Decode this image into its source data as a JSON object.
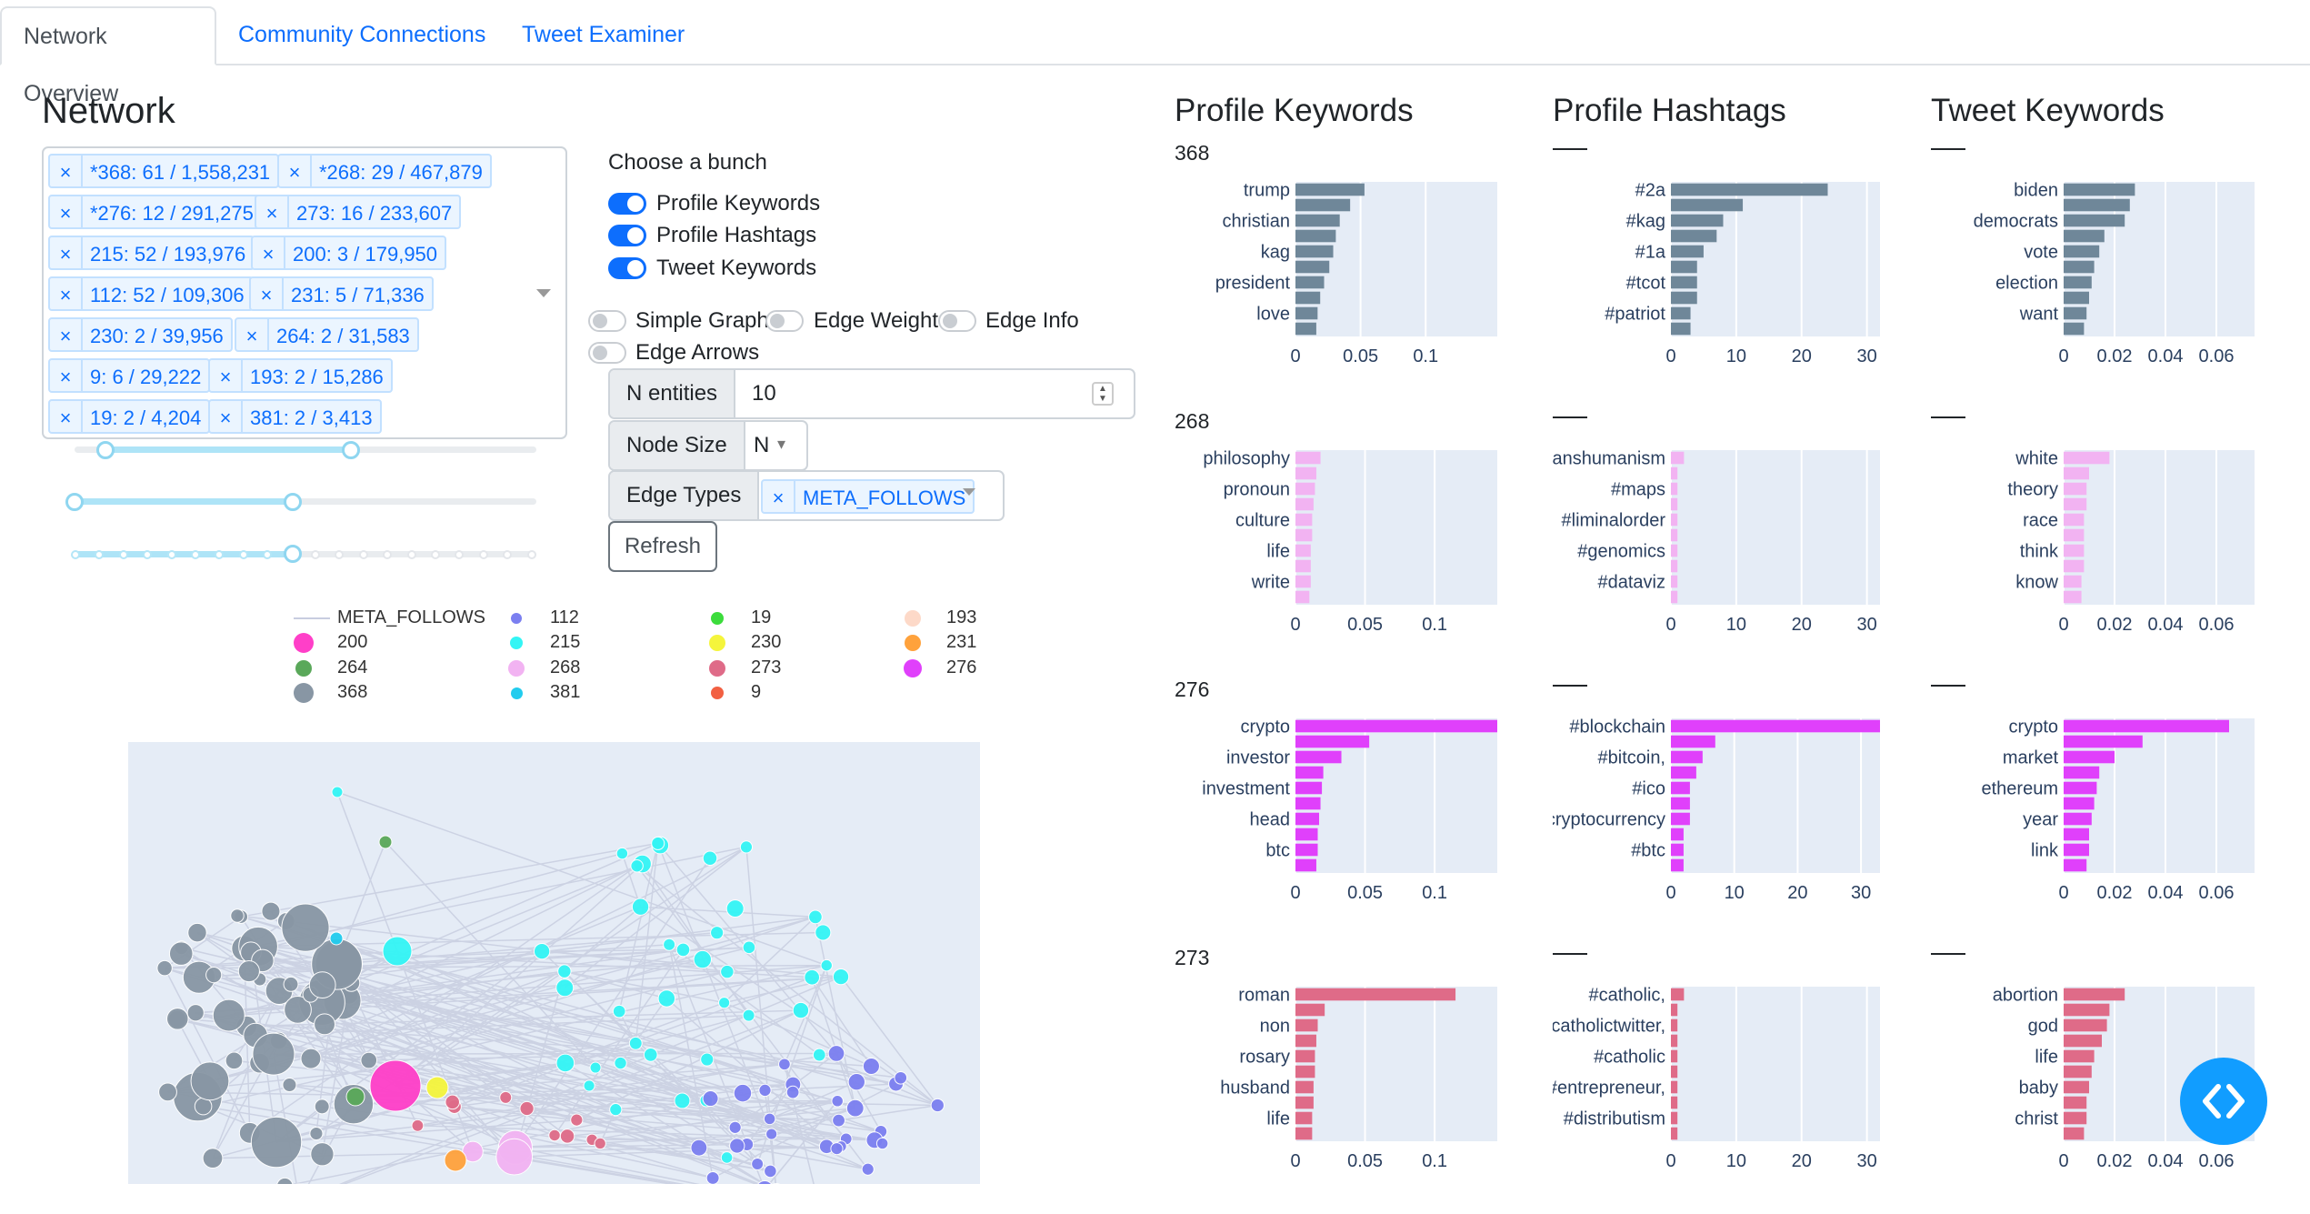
{
  "tabs": [
    {
      "label": "Network Overview",
      "active": true
    },
    {
      "label": "Community Connections",
      "active": false
    },
    {
      "label": "Tweet Examiner",
      "active": false
    }
  ],
  "network": {
    "title": "Network",
    "communities": [
      "*368: 61 / 1,558,231",
      "*268: 29 / 467,879",
      "*276: 12 / 291,275",
      "273: 16 / 233,607",
      "215: 52 / 193,976",
      "200: 3 / 179,950",
      "112: 52 / 109,306",
      "231: 5 / 71,336",
      "230: 2 / 39,956",
      "264: 2 / 31,583",
      "9: 6 / 29,222",
      "193: 2 / 15,286",
      "19: 2 / 4,204",
      "381: 2 / 3,413"
    ]
  },
  "controls": {
    "choose_label": "Choose a bunch",
    "toggles_on": [
      {
        "label": "Profile Keywords",
        "on": true
      },
      {
        "label": "Profile Hashtags",
        "on": true
      },
      {
        "label": "Tweet Keywords",
        "on": true
      }
    ],
    "toggles_off": [
      {
        "label": "Simple Graph",
        "on": false
      },
      {
        "label": "Edge Weight",
        "on": false
      },
      {
        "label": "Edge Info",
        "on": false
      },
      {
        "label": "Edge Arrows",
        "on": false
      }
    ],
    "n_entities_label": "N entities",
    "n_entities_value": "10",
    "node_size_label": "Node Size",
    "node_size_value": "N",
    "edge_types_label": "Edge Types",
    "edge_type_selected": "META_FOLLOWS",
    "refresh_label": "Refresh"
  },
  "legend": [
    {
      "label": "META_FOLLOWS",
      "type": "line",
      "color": "#c8cde0"
    },
    {
      "label": "112",
      "color": "#7b7ff0"
    },
    {
      "label": "19",
      "color": "#3cdc3c"
    },
    {
      "label": "193",
      "color": "#fdd9c8"
    },
    {
      "label": "200",
      "color": "#ff3fc8"
    },
    {
      "label": "215",
      "color": "#33f5f5"
    },
    {
      "label": "230",
      "color": "#f5f53c"
    },
    {
      "label": "231",
      "color": "#ffa23c"
    },
    {
      "label": "264",
      "color": "#5aa85a"
    },
    {
      "label": "268",
      "color": "#f2b3f2"
    },
    {
      "label": "273",
      "color": "#df6b88"
    },
    {
      "label": "276",
      "color": "#e040fb"
    },
    {
      "label": "368",
      "color": "#8896a4"
    },
    {
      "label": "381",
      "color": "#22ccee"
    },
    {
      "label": "9",
      "color": "#f26042"
    }
  ],
  "headers": {
    "profile_keywords": "Profile Keywords",
    "profile_hashtags": "Profile Hashtags",
    "tweet_keywords": "Tweet Keywords"
  },
  "chart_data": [
    {
      "type": "bar",
      "orientation": "horizontal",
      "row_label": "368",
      "column": "Profile Keywords",
      "color": "#6f8799",
      "categories": [
        "trump",
        "christian",
        "kag",
        "president",
        "love"
      ],
      "tick_labels_y": [
        "trump",
        "christian",
        "kag",
        "president",
        "love"
      ],
      "values": [
        0.053,
        0.042,
        0.034,
        0.031,
        0.029,
        0.026,
        0.022,
        0.019,
        0.017,
        0.016
      ],
      "xticks": [
        "0",
        "0.05",
        "0.1"
      ],
      "xlim": [
        0,
        0.155
      ]
    },
    {
      "type": "bar",
      "orientation": "horizontal",
      "row_label": "",
      "column": "Profile Hashtags",
      "color": "#6f8799",
      "categories": [
        "#2a",
        "#kag",
        "#1a",
        "#tcot",
        "#patriot"
      ],
      "values": [
        24,
        11,
        8,
        7,
        5,
        4,
        4,
        4,
        3,
        3
      ],
      "xticks": [
        "0",
        "10",
        "20",
        "30"
      ],
      "xlim": [
        0,
        32
      ]
    },
    {
      "type": "bar",
      "orientation": "horizontal",
      "row_label": "",
      "column": "Tweet Keywords",
      "color": "#6f8799",
      "categories": [
        "biden",
        "democrats",
        "vote",
        "election",
        "want"
      ],
      "values": [
        0.028,
        0.026,
        0.024,
        0.016,
        0.014,
        0.012,
        0.011,
        0.01,
        0.009,
        0.008
      ],
      "xticks": [
        "0",
        "0.02",
        "0.04",
        "0.06"
      ],
      "xlim": [
        0,
        0.075
      ]
    },
    {
      "type": "bar",
      "orientation": "horizontal",
      "row_label": "268",
      "column": "Profile Keywords",
      "color": "#f2b3f2",
      "categories": [
        "philosophy",
        "pronoun",
        "culture",
        "life",
        "write"
      ],
      "values": [
        0.018,
        0.015,
        0.014,
        0.013,
        0.012,
        0.012,
        0.011,
        0.011,
        0.011,
        0.01
      ],
      "xticks": [
        "0",
        "0.05",
        "0.1"
      ],
      "xlim": [
        0,
        0.145
      ]
    },
    {
      "type": "bar",
      "orientation": "horizontal",
      "row_label": "",
      "column": "Profile Hashtags",
      "color": "#f2b3f2",
      "categories": [
        "#transhumanism",
        "#maps",
        "#liminalorder",
        "#genomics",
        "#dataviz"
      ],
      "values": [
        2,
        1,
        1,
        1,
        1,
        1,
        1,
        1,
        1,
        1
      ],
      "xticks": [
        "0",
        "10",
        "20",
        "30"
      ],
      "xlim": [
        0,
        32
      ]
    },
    {
      "type": "bar",
      "orientation": "horizontal",
      "row_label": "",
      "column": "Tweet Keywords",
      "color": "#f2b3f2",
      "categories": [
        "white",
        "theory",
        "race",
        "think",
        "know"
      ],
      "values": [
        0.018,
        0.01,
        0.009,
        0.009,
        0.008,
        0.008,
        0.008,
        0.008,
        0.007,
        0.007
      ],
      "xticks": [
        "0",
        "0.02",
        "0.04",
        "0.06"
      ],
      "xlim": [
        0,
        0.075
      ]
    },
    {
      "type": "bar",
      "orientation": "horizontal",
      "row_label": "276",
      "column": "Profile Keywords",
      "color": "#e040fb",
      "categories": [
        "crypto",
        "investor",
        "investment",
        "head",
        "btc"
      ],
      "values": [
        0.145,
        0.053,
        0.033,
        0.02,
        0.019,
        0.018,
        0.017,
        0.016,
        0.016,
        0.015
      ],
      "xticks": [
        "0",
        "0.05",
        "0.1"
      ],
      "xlim": [
        0,
        0.145
      ]
    },
    {
      "type": "bar",
      "orientation": "horizontal",
      "row_label": "",
      "column": "Profile Hashtags",
      "color": "#e040fb",
      "categories": [
        "#blockchain",
        "#bitcoin,",
        "#ico",
        "#cryptocurrency",
        "#btc"
      ],
      "values": [
        33,
        7,
        5,
        4,
        3,
        3,
        3,
        2,
        2,
        2
      ],
      "xticks": [
        "0",
        "10",
        "20",
        "30"
      ],
      "xlim": [
        0,
        33
      ]
    },
    {
      "type": "bar",
      "orientation": "horizontal",
      "row_label": "",
      "column": "Tweet Keywords",
      "color": "#e040fb",
      "categories": [
        "crypto",
        "market",
        "ethereum",
        "year",
        "link"
      ],
      "values": [
        0.065,
        0.031,
        0.02,
        0.014,
        0.013,
        0.012,
        0.011,
        0.01,
        0.01,
        0.009
      ],
      "xticks": [
        "0",
        "0.02",
        "0.04",
        "0.06"
      ],
      "xlim": [
        0,
        0.075
      ]
    },
    {
      "type": "bar",
      "orientation": "horizontal",
      "row_label": "273",
      "column": "Profile Keywords",
      "color": "#df6b88",
      "categories": [
        "roman",
        "non",
        "rosary",
        "husband",
        "life"
      ],
      "values": [
        0.115,
        0.021,
        0.016,
        0.015,
        0.014,
        0.014,
        0.013,
        0.013,
        0.012,
        0.012
      ],
      "xticks": [
        "0",
        "0.05",
        "0.1"
      ],
      "xlim": [
        0,
        0.145
      ]
    },
    {
      "type": "bar",
      "orientation": "horizontal",
      "row_label": "",
      "column": "Profile Hashtags",
      "color": "#df6b88",
      "categories": [
        "#catholic,",
        "#catholictwitter,",
        "#catholic",
        "#entrepreneur,",
        "#distributism"
      ],
      "values": [
        2,
        1,
        1,
        1,
        1,
        1,
        1,
        1,
        1,
        1
      ],
      "xticks": [
        "0",
        "10",
        "20",
        "30"
      ],
      "xlim": [
        0,
        32
      ]
    },
    {
      "type": "bar",
      "orientation": "horizontal",
      "row_label": "",
      "column": "Tweet Keywords",
      "color": "#df6b88",
      "categories": [
        "abortion",
        "god",
        "life",
        "baby",
        "christ"
      ],
      "values": [
        0.024,
        0.018,
        0.017,
        0.015,
        0.012,
        0.011,
        0.01,
        0.009,
        0.009,
        0.008
      ],
      "xticks": [
        "0",
        "0.02",
        "0.04",
        "0.06"
      ],
      "xlim": [
        0,
        0.075
      ]
    }
  ]
}
